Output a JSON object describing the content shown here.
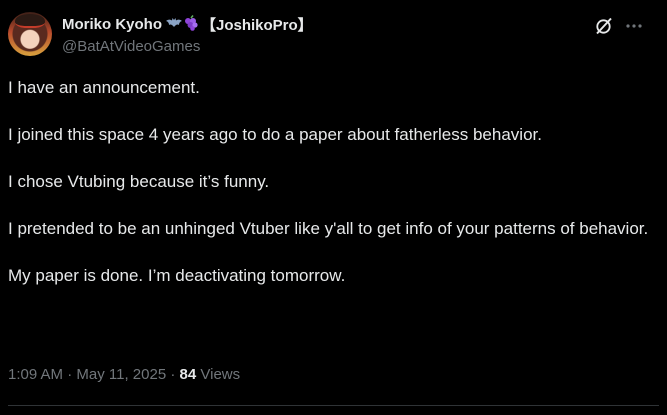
{
  "author": {
    "display_name": "Moriko Kyoho",
    "badges": "🦇🍇",
    "tag": "【JoshikoPro】",
    "handle": "@BatAtVideoGames"
  },
  "tweet": {
    "paragraphs": [
      "I have an announcement.",
      "I joined this space 4 years ago to do a paper about fatherless behavior.",
      "I chose Vtubing because it’s funny.",
      "I pretended to be an unhinged Vtuber like y'all to get info of your patterns of behavior.",
      "My paper is done. I’m deactivating tomorrow."
    ],
    "time": "1:09 AM",
    "date": "May 11, 2025",
    "separator": "·",
    "views_count": "84",
    "views_label": "Views"
  },
  "icons": {
    "grok": "grok-icon",
    "more": "more-icon"
  },
  "colors": {
    "background": "#000000",
    "text": "#e7e9ea",
    "secondary": "#71767b",
    "divider": "#2f3336"
  }
}
